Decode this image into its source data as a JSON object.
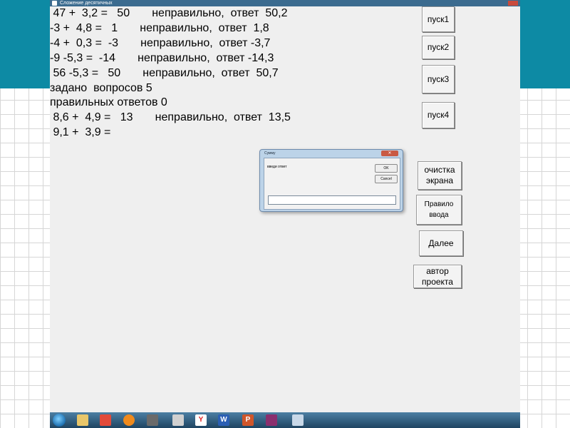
{
  "window": {
    "title": "Сложение десятичных"
  },
  "output_lines": [
    " 47 +  3,2 =   50       неправильно,  ответ  50,2",
    "-3 +  4,8 =   1       неправильно,  ответ  1,8",
    "-4 +  0,3 =  -3       неправильно,  ответ -3,7",
    "-9 -5,3 =  -14       неправильно,  ответ -14,3",
    " 56 -5,3 =   50       неправильно,  ответ  50,7",
    "задано  вопросов 5",
    "правильных ответов 0",
    " 8,6 +  4,9 =   13       неправильно,  ответ  13,5",
    " 9,1 +  3,9 ="
  ],
  "buttons": {
    "start1": "пуск1",
    "start2": "пуск2",
    "start3": "пуск3",
    "start4": "пуск4",
    "clear_line1": "очистка",
    "clear_line2": "экрана",
    "rules_line1": "Правило",
    "rules_line2": "ввода",
    "next": "Далее",
    "author_line1": "автор",
    "author_line2": "проекта"
  },
  "dialog": {
    "title": "Сумму",
    "prompt": "введи ответ",
    "ok": "OK",
    "cancel": "Cancel",
    "close": "✕",
    "input_value": ""
  },
  "taskbar": {
    "icons": [
      "start-orb",
      "explorer",
      "yandex-browser",
      "media-player",
      "app",
      "opera",
      "yandex",
      "word",
      "powerpoint",
      "winrar",
      "folder"
    ]
  },
  "colors": {
    "teal_band": "#0d8aa4",
    "window_bg": "#efefef",
    "dialog_frame": "#bcd3e8"
  }
}
